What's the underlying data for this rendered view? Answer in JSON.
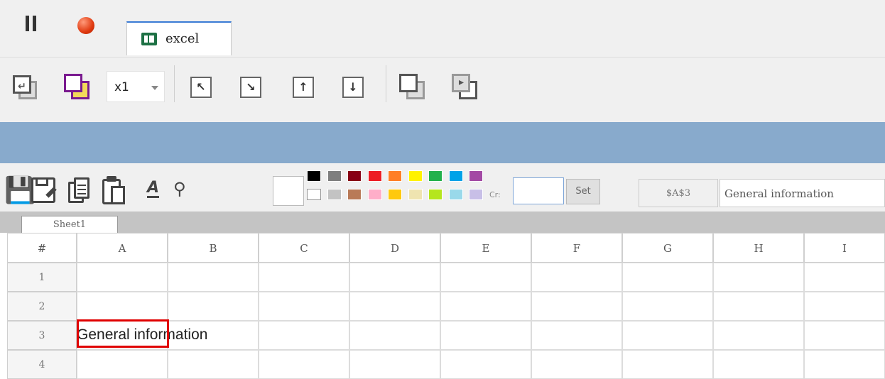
{
  "tab": {
    "label": "excel"
  },
  "zoom": {
    "value": "x1"
  },
  "sheet": {
    "tab_label": "Sheet1",
    "cell_ref": "$A$3",
    "formula": "General information",
    "set_label": "Set",
    "cr_label": "Cr:"
  },
  "columns": [
    "#",
    "A",
    "B",
    "C",
    "D",
    "E",
    "F",
    "G",
    "H",
    "I"
  ],
  "rows": [
    "1",
    "2",
    "3",
    "4"
  ],
  "cell_A3": "General information",
  "palette_top": [
    "#000000",
    "#7f7f7f",
    "#880015",
    "#ed1c24",
    "#ff7f27",
    "#fff200",
    "#22b14c",
    "#00a2e8",
    "#a349a4"
  ],
  "palette_bottom": [
    "#ffffff",
    "#c3c3c3",
    "#b97a57",
    "#ffaec9",
    "#ffc90e",
    "#efe4b0",
    "#b5e61d",
    "#99d9ea",
    "#c8bfe7"
  ]
}
